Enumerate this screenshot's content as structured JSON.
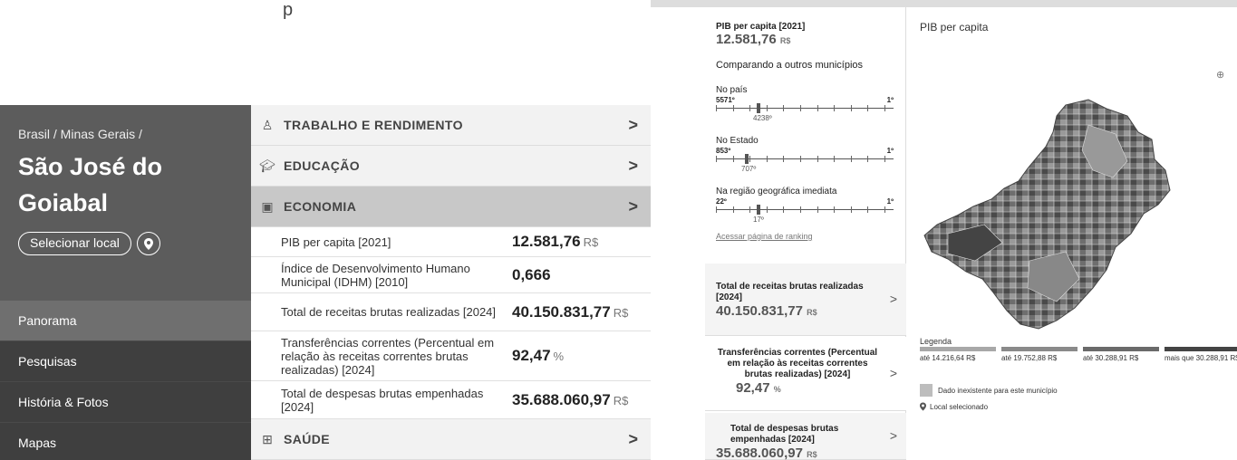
{
  "left": {
    "top_text": "p",
    "breadcrumb": "Brasil / Minas Gerais /",
    "city": "São José do Goiabal",
    "select_place": "Selecionar local",
    "nav": [
      "Panorama",
      "Pesquisas",
      "História & Fotos",
      "Mapas"
    ],
    "sections": {
      "trabalho": "TRABALHO E RENDIMENTO",
      "educacao": "EDUCAÇÃO",
      "economia": "ECONOMIA",
      "saude": "SAÚDE"
    },
    "economy_rows": [
      {
        "label": "PIB per capita [2021]",
        "value": "12.581,76",
        "unit": "R$"
      },
      {
        "label": "Índice de Desenvolvimento Humano Municipal (IDHM) [2010]",
        "value": "0,666",
        "unit": ""
      },
      {
        "label": "Total de receitas brutas realizadas [2024]",
        "value": "40.150.831,77",
        "unit": "R$"
      },
      {
        "label": "Transferências correntes (Percentual em relação às receitas correntes brutas realizadas) [2024]",
        "value": "92,47",
        "unit": "%"
      },
      {
        "label": "Total de despesas brutas empenhadas [2024]",
        "value": "35.688.060,97",
        "unit": "R$"
      }
    ]
  },
  "right": {
    "pib_title": "PIB per capita [2021]",
    "pib_value": "12.581,76",
    "pib_unit": "R$",
    "compare_title": "Comparando a outros municípios",
    "rankings": [
      {
        "title": "No país",
        "min": "5571º",
        "max": "1º",
        "position": "4238º",
        "fraction": 0.24
      },
      {
        "title": "No Estado",
        "min": "853º",
        "max": "1º",
        "position": "707º",
        "fraction": 0.17
      },
      {
        "title": "Na região geográfica imediata",
        "min": "22º",
        "max": "1º",
        "position": "17º",
        "fraction": 0.24
      }
    ],
    "ranking_link": "Acessar página de ranking",
    "cards": [
      {
        "title": "Total de receitas brutas realizadas [2024]",
        "value": "40.150.831,77",
        "unit": "R$"
      },
      {
        "title": "Transferências correntes (Percentual em relação às receitas correntes brutas realizadas) [2024]",
        "value": "92,47",
        "unit": "%"
      },
      {
        "title": "Total de despesas brutas empenhadas [2024]",
        "value": "35.688.060,97",
        "unit": "R$"
      }
    ],
    "map_title": "PIB per capita",
    "legend_title": "Legenda",
    "legend_bins": [
      {
        "label": "até 14.216,64 R$",
        "color": "#a8a8a8"
      },
      {
        "label": "até 19.752,88 R$",
        "color": "#8a8a8a"
      },
      {
        "label": "até 30.288,91 R$",
        "color": "#6a6a6a"
      },
      {
        "label": "mais que 30.288,91 R$",
        "color": "#444444"
      }
    ],
    "legend_none": "Dado inexistente para este município",
    "legend_selected": "Local selecionado"
  }
}
